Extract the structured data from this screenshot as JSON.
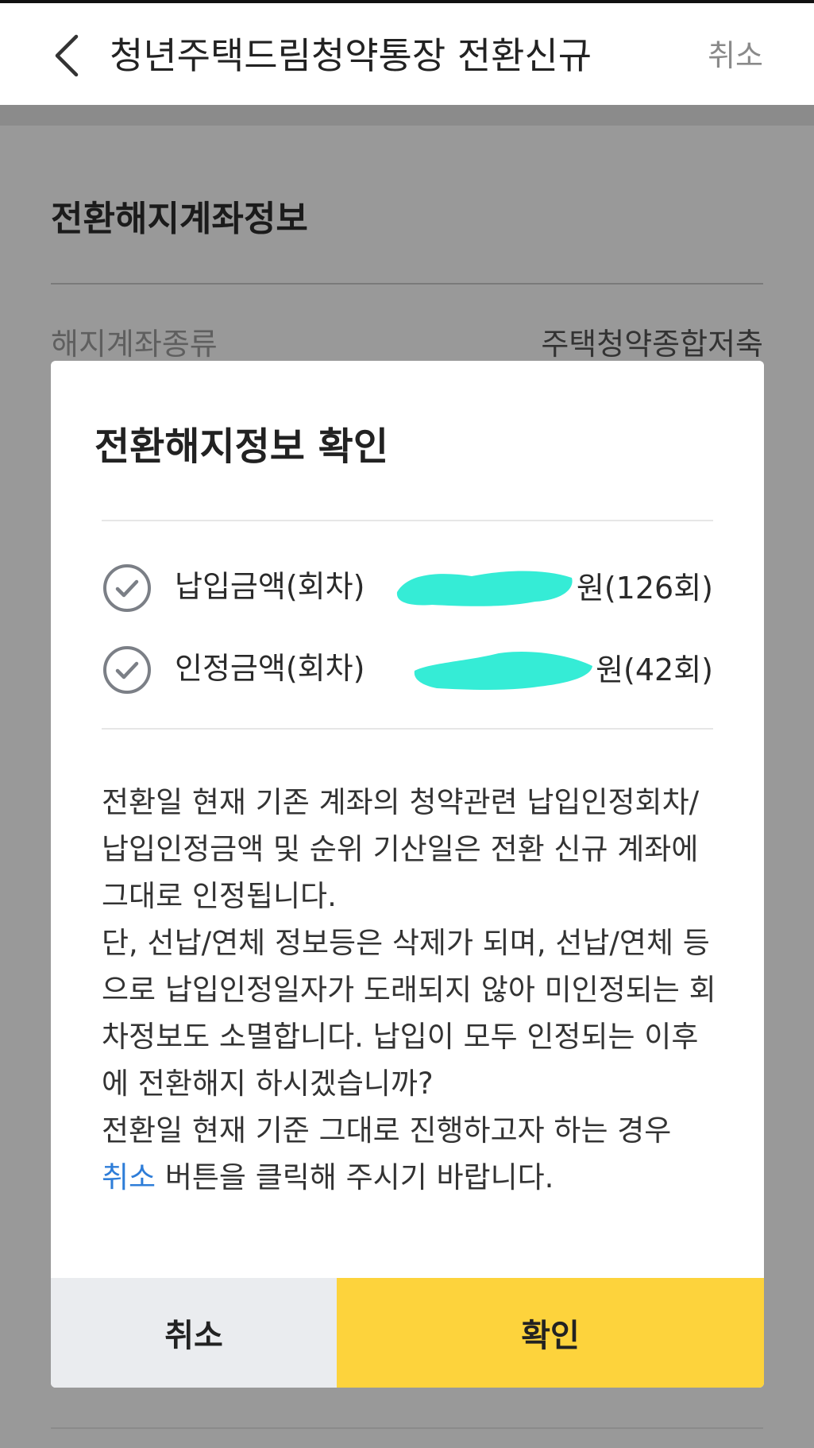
{
  "header": {
    "title": "청년주택드림청약통장 전환신규",
    "cancel_label": "취소"
  },
  "background": {
    "section_title": "전환해지계좌정보",
    "row_label": "해지계좌종류",
    "row_value": "주택청약종합저축"
  },
  "dialog": {
    "title": "전환해지정보 확인",
    "rows": [
      {
        "label": "납입금액(회차)",
        "value_tail": "원(126회)"
      },
      {
        "label": "인정금액(회차)",
        "value_tail": "원(42회)"
      }
    ],
    "body": {
      "line1": "전환일 현재 기존 계좌의 청약관련 납입인정회차/납입인정금액 및 순위 기산일은 전환 신규 계좌에 그대로 인정됩니다.",
      "line2": "단, 선납/연체 정보등은 삭제가 되며, 선납/연체 등으로 납입인정일자가 도래되지 않아 미인정되는 회차정보도 소멸합니다. 납입이 모두 인정되는 이후에 전환해지 하시겠습니까?",
      "line3_prefix": "전환일 현재 기준 그대로 진행하고자 하는 경우",
      "line3_link": "취소",
      "line3_suffix": " 버튼을 클릭해 주시기 바랍니다."
    },
    "cancel_button": "취소",
    "confirm_button": "확인"
  },
  "colors": {
    "accent_yellow": "#fdd33c",
    "link_blue": "#2e7dd8",
    "redaction": "#35ecd6",
    "overlay_gray": "#999999"
  },
  "icons": [
    "back-chevron-icon",
    "check-circle-icon"
  ]
}
